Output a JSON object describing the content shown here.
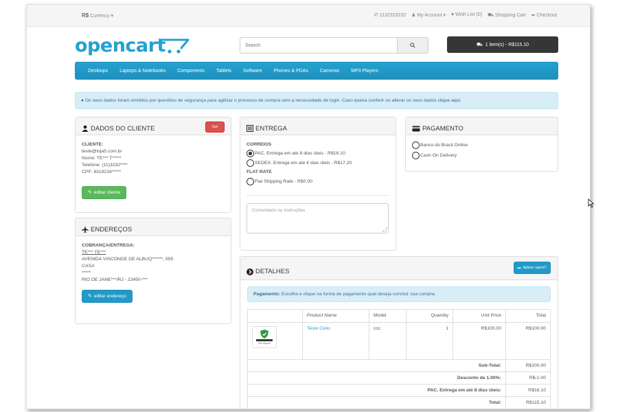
{
  "topbar": {
    "currency_symbol": "R$",
    "currency_label": "Currency",
    "phone": "1132323232",
    "my_account": "My Account",
    "wish_list": "Wish List (0)",
    "shopping_cart": "Shopping Cart",
    "checkout": "Checkout"
  },
  "header": {
    "logo": "opencart",
    "search_placeholder": "Search",
    "cart_button": "1 item(s) - R$115.10"
  },
  "menu": [
    "Desktops",
    "Laptops & Notebooks",
    "Components",
    "Tablets",
    "Software",
    "Phones & PDAs",
    "Cameras",
    "MP3 Players"
  ],
  "alert": {
    "text": "Os seus dados foram omitidos por questões de segurança para agilizar o processo de compra sem a necessidade de login. Caso queira conferir ou alterar os seus dados ",
    "link": "clique aqui."
  },
  "cliente": {
    "title": "DADOS DO CLIENTE",
    "exit_button": "Sair",
    "label": "CLIENTE:",
    "email": "teste@loja5.com.br",
    "nome": "Nome: TE*** T*****",
    "telefone": "Telefone: (11)3232****",
    "cpf": "CPF: 8319218*****",
    "edit_button": "editar cliente"
  },
  "enderecos": {
    "title": "ENDEREÇOS",
    "label": "COBRANÇA/ENTREGA:",
    "name": "TE*** TE***",
    "street": "AVENIDA VISCONDE DE ALBUQ******, 555",
    "complement": "CASA",
    "hidden": "*****",
    "city": "RIO DE JANE***/RJ - 22450-***",
    "edit_button": "editar endereço"
  },
  "entrega": {
    "title": "ENTREGA",
    "group1": "CORREIOS",
    "options": [
      {
        "label": "PAC. Entrega em até 8 dias úteis - R$16.10",
        "selected": true
      },
      {
        "label": "SEDEX. Entrega em até 4 dias úteis - R$17.20",
        "selected": false
      }
    ],
    "group2": "FLAT RATE",
    "flat_option": {
      "label": "Flat Shipping Rate - R$0.00",
      "selected": false
    },
    "comment_placeholder": "Comentario ou instruções"
  },
  "pagamento": {
    "title": "PAGAMENTO",
    "options": [
      "Banco do Brasil Online",
      "Cash On Delivery"
    ]
  },
  "detalhes": {
    "title": "DETALHES",
    "coupon_button": "Aplicar cupom?",
    "info_label": "Pagamento:",
    "info_text": " Escolha e clique na forma de pagamento qual deseja concluir sua compra.",
    "columns": [
      "Product Name",
      "Model",
      "Quantity",
      "Unit Price",
      "Total"
    ],
    "product": {
      "name": "Teste Cielo",
      "model": "ccc",
      "quantity": "1",
      "unit_price": "R$100.00",
      "total": "R$100.00",
      "thumb_caption": "Site Seguro"
    },
    "totals": [
      {
        "label": "Sub-Total:",
        "value": "R$100.00"
      },
      {
        "label": "Desconto de 1.00%:",
        "value": "R$-1.00"
      },
      {
        "label": "PAC. Entrega em até 8 dias úteis:",
        "value": "R$16.10"
      },
      {
        "label": "Total:",
        "value": "R$115.10"
      }
    ]
  }
}
